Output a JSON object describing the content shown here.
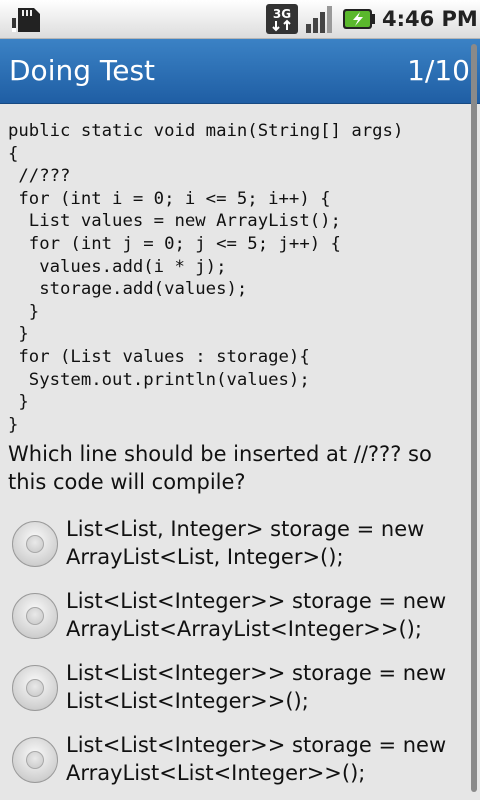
{
  "status_bar": {
    "network_label": "3G",
    "time": "4:46 PM"
  },
  "title_bar": {
    "title": "Doing Test",
    "progress": "1/10"
  },
  "question": {
    "code": "public static void main(String[] args)\n{\n //???\n for (int i = 0; i <= 5; i++) {\n  List values = new ArrayList();\n  for (int j = 0; j <= 5; j++) {\n   values.add(i * j);\n   storage.add(values);\n  }\n }\n for (List values : storage){\n  System.out.println(values);\n }\n}",
    "text": "Which line should be inserted at //??? so this code will compile?"
  },
  "options": [
    {
      "label": "List<List, Integer> storage = new ArrayList<List, Integer>();",
      "selected": false
    },
    {
      "label": "List<List<Integer>> storage = new ArrayList<ArrayList<Integer>>();",
      "selected": false
    },
    {
      "label": "List<List<Integer>> storage = new List<List<Integer>>();",
      "selected": false
    },
    {
      "label": "List<List<Integer>> storage = new ArrayList<List<Integer>>();",
      "selected": false
    }
  ]
}
